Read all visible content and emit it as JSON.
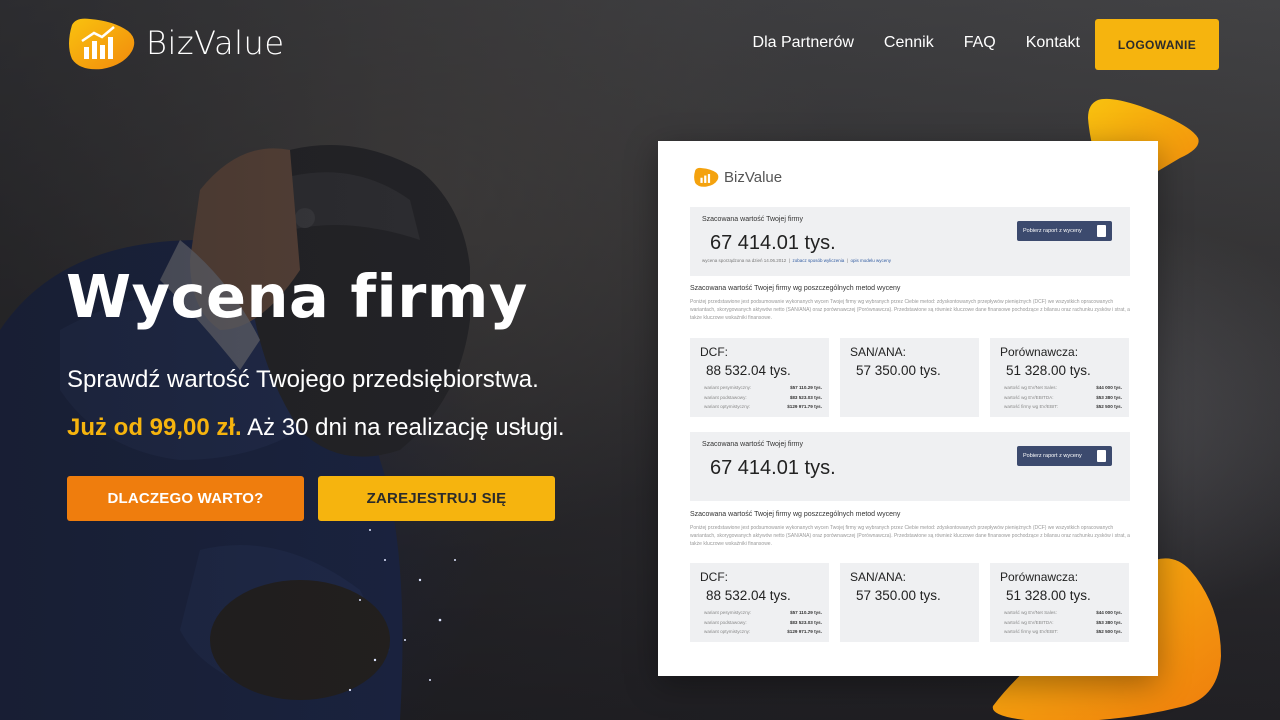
{
  "brand": {
    "name": "BizValue",
    "accent": "#f6b40e",
    "accent_orange": "#ef7d0d"
  },
  "nav": {
    "items": [
      "Dla Partnerów",
      "Cennik",
      "FAQ",
      "Kontakt"
    ],
    "login_label": "LOGOWANIE"
  },
  "hero": {
    "title": "Wycena firmy",
    "subtitle": "Sprawdź wartość Twojego przedsiębiorstwa.",
    "price_highlight": "Już od 99,00 zł.",
    "price_rest": " Aż 30 dni na realizację usługi.",
    "btn_why": "DLACZEGO WARTO?",
    "btn_register": "ZAREJESTRUJ SIĘ"
  },
  "report": {
    "logo_text": "BizValue",
    "panel": {
      "label": "Szacowana wartość Twojej firmy",
      "value": "67 414.01 tys.",
      "meta_date": "wycena sporządzona na dzień 14.06.2012",
      "meta_link1": "zobacz sposób wyliczenia",
      "meta_link2": "opis modelu wyceny",
      "download_label": "Pobierz raport z wyceny"
    },
    "section_title": "Szacowana wartość Twojej firmy wg poszczególnych metod wyceny",
    "lorem": "Poniżej przedstawione jest podsumowanie wykonanych wycen Twojej firmy wg wybranych przez Ciebie metod: zdyskontowanych przepływów pieniężnych (DCF) we wszystkich opracowanych wariantach, skorygowanych aktywów netto (SAN/ANA) oraz porównawczej (Porównawcza). Przedstawione są również kluczowe dane finansowe pochodzące z bilansu oraz rachunku zysków i strat, a także kluczowe wskaźniki finansowe.",
    "cards": [
      {
        "title": "DCF:",
        "value": "88 532.04 tys.",
        "rows": [
          {
            "label": "wariant pesymistyczny:",
            "value": "$57 110.29 tys."
          },
          {
            "label": "wariant podstawowy:",
            "value": "$83 523.03 tys."
          },
          {
            "label": "wariant optymistyczny:",
            "value": "$129 971.79 tys."
          }
        ]
      },
      {
        "title": "SAN/ANA:",
        "value": "57 350.00 tys.",
        "rows": []
      },
      {
        "title": "Porównawcza:",
        "value": "51 328.00 tys.",
        "rows": [
          {
            "label": "wartość wg EV/Net Sales:",
            "value": "$44 000 tys."
          },
          {
            "label": "wartość wg EV/EBITDA:",
            "value": "$53 380 tys."
          },
          {
            "label": "wartość firmy wg EV/EBIT:",
            "value": "$52 500 tys."
          }
        ]
      }
    ]
  }
}
